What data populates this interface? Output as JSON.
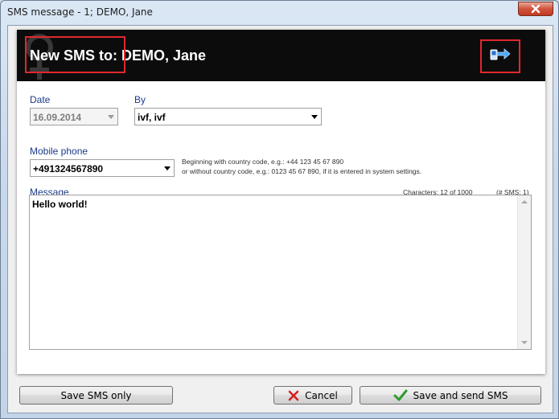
{
  "window": {
    "title": "SMS message - 1; DEMO, Jane"
  },
  "header": {
    "title": "New SMS to: DEMO, Jane"
  },
  "form": {
    "date_label": "Date",
    "date_value": "16.09.2014",
    "by_label": "By",
    "by_value": "ivf, ivf",
    "mobile_label": "Mobile phone",
    "mobile_value": "+491324567890",
    "hint_line1": "Beginning with country code, e.g.: +44 123 45 67 890",
    "hint_line2": "or without country code, e.g.: 0123 45 67 890, if it is entered in system settings.",
    "message_label": "Message",
    "characters": "Characters: 12 of 1000",
    "sms_count": "(# SMS: 1)",
    "message_text": "Hello world!"
  },
  "buttons": {
    "save_only": "Save SMS only",
    "cancel": "Cancel",
    "save_send": "Save and send SMS"
  },
  "icons": {
    "close": "close-icon",
    "send": "send-sms-icon",
    "cancel": "red-x-icon",
    "save_send": "green-check-icon"
  },
  "colors": {
    "header_bg": "#0c0c0c",
    "label": "#1a3a8a",
    "highlight": "#e0282e"
  }
}
